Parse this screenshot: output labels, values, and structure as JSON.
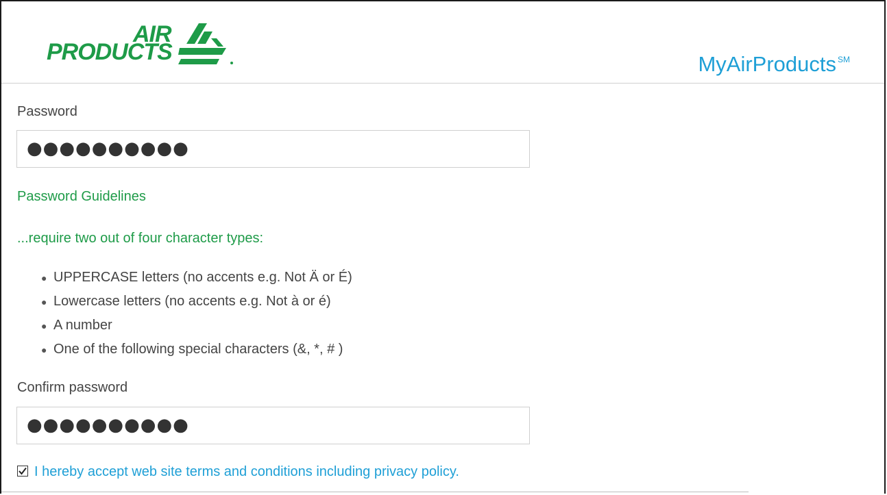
{
  "header": {
    "logo_air": "AIR",
    "logo_products": "PRODUCTS",
    "brand_title": "MyAirProducts",
    "brand_mark": "SM"
  },
  "password": {
    "label": "Password",
    "value": "●●●●●●●●●●"
  },
  "guidelines": {
    "title": "Password Guidelines",
    "subtitle": "...require two out of four character types:",
    "rules": [
      "UPPERCASE letters (no accents e.g. Not Ä or É)",
      "Lowercase letters (no accents e.g. Not à or é)",
      "A number",
      "One of the following special characters (&, *, # )"
    ]
  },
  "confirm": {
    "label": "Confirm password",
    "value": "●●●●●●●●●●"
  },
  "terms": {
    "checked": true,
    "label": "I hereby accept web site terms and conditions including privacy policy."
  },
  "colors": {
    "brand_green": "#1e9b48",
    "link_blue": "#1e9fd6"
  }
}
